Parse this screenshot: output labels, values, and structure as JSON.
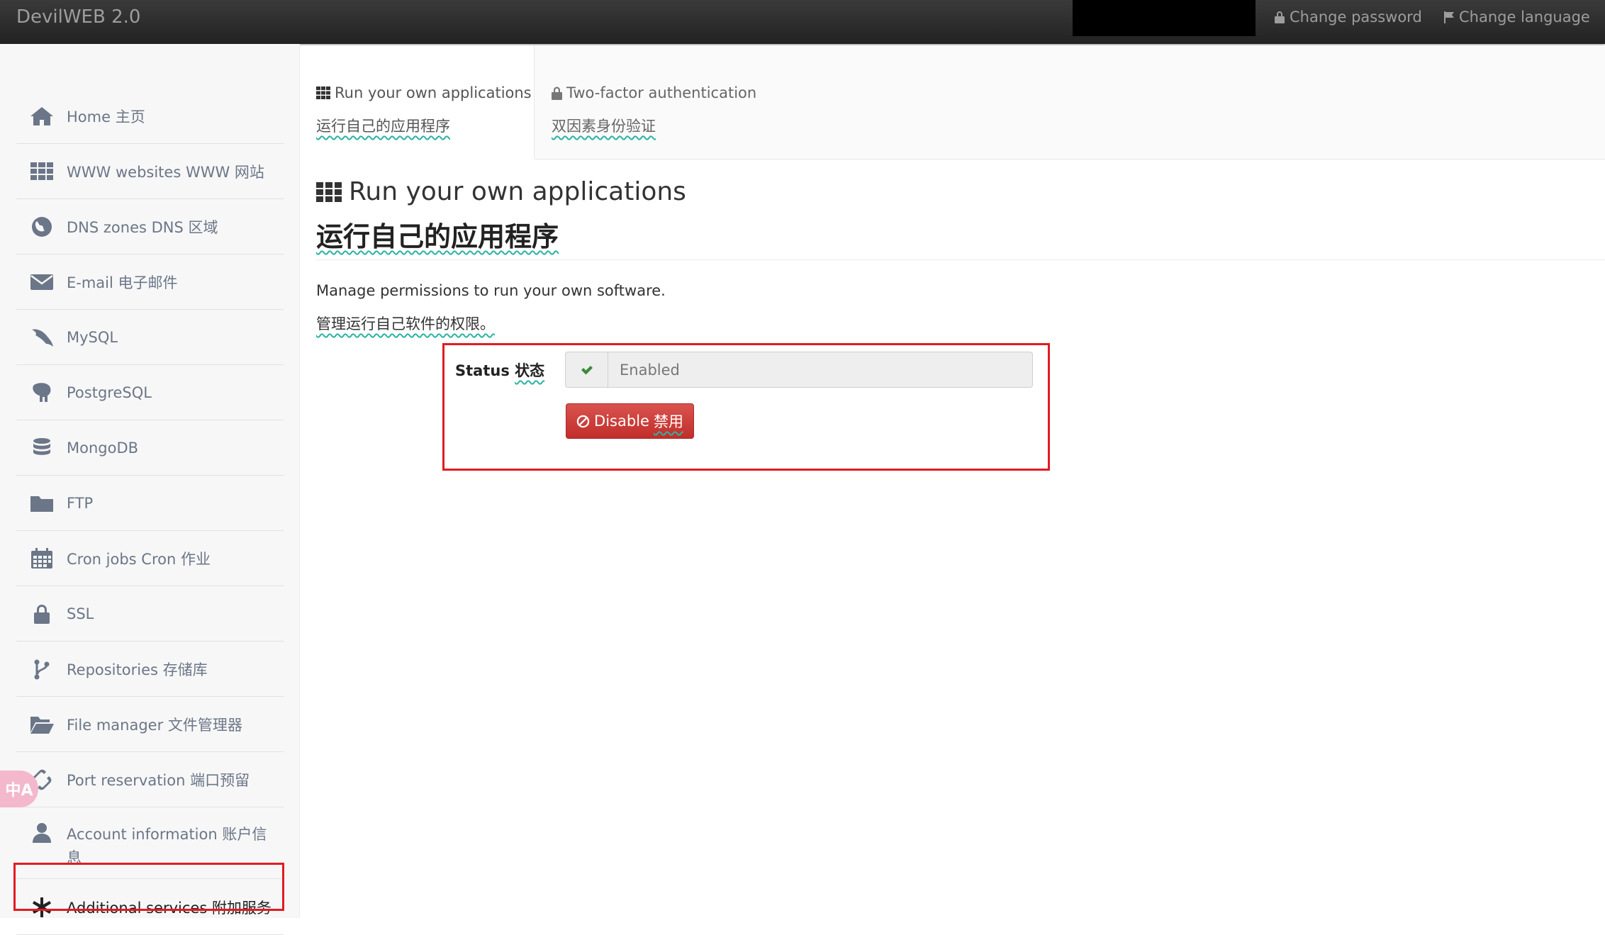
{
  "navbar": {
    "brand": "DevilWEB 2.0",
    "change_password": "Change password",
    "change_language": "Change language"
  },
  "sidebar": {
    "items": [
      {
        "label": "Home 主页",
        "icon": "home-icon"
      },
      {
        "label": "WWW websites WWW 网站",
        "icon": "grid-icon"
      },
      {
        "label": "DNS zones DNS 区域",
        "icon": "globe-icon"
      },
      {
        "label": "E-mail 电子邮件",
        "icon": "envelope-icon"
      },
      {
        "label": "MySQL",
        "icon": "dolphin-icon"
      },
      {
        "label": "PostgreSQL",
        "icon": "elephant-icon"
      },
      {
        "label": "MongoDB",
        "icon": "database-icon"
      },
      {
        "label": "FTP",
        "icon": "folder-icon"
      },
      {
        "label": "Cron jobs Cron 作业",
        "icon": "calendar-icon"
      },
      {
        "label": "SSL",
        "icon": "lock-icon"
      },
      {
        "label": "Repositories 存储库",
        "icon": "branch-icon"
      },
      {
        "label": "File manager 文件管理器",
        "icon": "folder-open-icon"
      },
      {
        "label": "Port reservation 端口预留",
        "icon": "plug-icon"
      },
      {
        "label": "Account information 账户信息",
        "icon": "user-icon"
      },
      {
        "label": "Additional services 附加服务",
        "icon": "asterisk-icon"
      }
    ],
    "translate_badge": "中A"
  },
  "tabs": [
    {
      "label": "Run your own applications",
      "translation": "运行自己的应用程序",
      "icon": "grid-icon"
    },
    {
      "label": "Two-factor authentication",
      "translation": "双因素身份验证",
      "icon": "lock-icon"
    }
  ],
  "main": {
    "title": "Run your own applications",
    "title_translation": "运行自己的应用程序",
    "description": "Manage permissions to run your own software.",
    "description_translation": "管理运行自己软件的权限。",
    "status_label": "Status",
    "status_label_translation": "状态",
    "status_value": "Enabled",
    "disable_button": "Disable",
    "disable_button_translation": "禁用"
  },
  "colors": {
    "highlight": "#e21b23",
    "danger_button": "#d9534f",
    "sidebar_text": "#6b7688",
    "navbar": "#2b2b2b"
  }
}
